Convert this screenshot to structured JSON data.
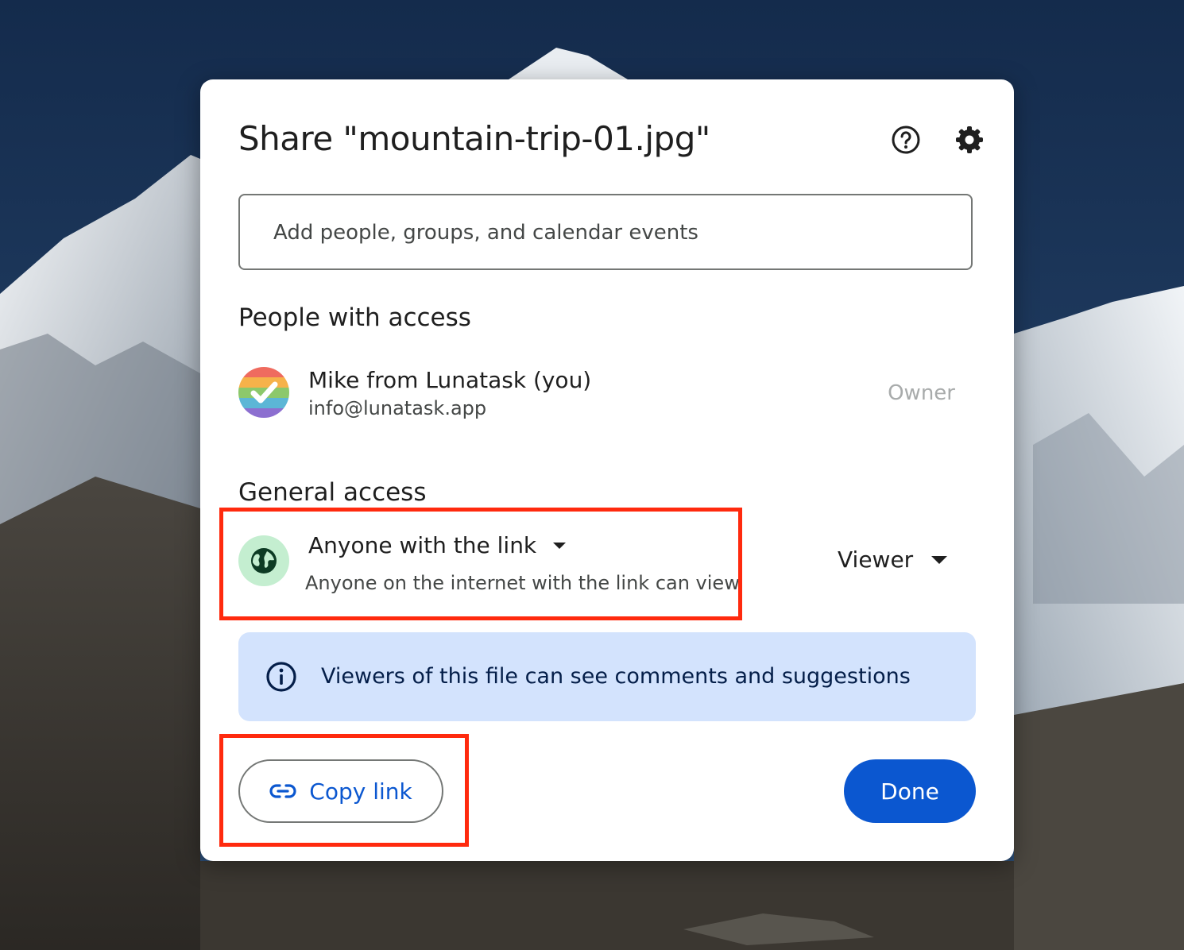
{
  "dialog": {
    "title": "Share \"mountain-trip-01.jpg\"",
    "help_icon": "help-circle-icon",
    "settings_icon": "gear-icon"
  },
  "search": {
    "placeholder": "Add people, groups, and calendar events",
    "value": ""
  },
  "people_section": {
    "heading": "People with access",
    "people": [
      {
        "name": "Mike from Lunatask (you)",
        "email": "info@lunatask.app",
        "role": "Owner"
      }
    ]
  },
  "general_access": {
    "heading": "General access",
    "scope": "Anyone with the link",
    "description": "Anyone on the internet with the link can view",
    "role": "Viewer",
    "icon": "globe-icon"
  },
  "info_banner": {
    "text": "Viewers of this file can see comments and suggestions",
    "icon": "info-icon"
  },
  "actions": {
    "copy_link": "Copy link",
    "done": "Done"
  },
  "colors": {
    "primary": "#0b57d0",
    "info_bg": "#d3e3fd",
    "globe_bg": "#c4eed0",
    "highlight": "#ff2a0e"
  }
}
